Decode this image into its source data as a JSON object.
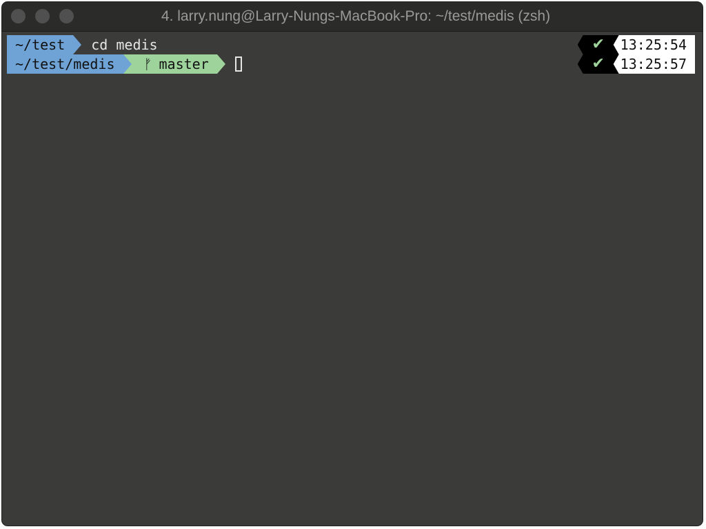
{
  "window": {
    "title": "4. larry.nung@Larry-Nungs-MacBook-Pro: ~/test/medis (zsh)"
  },
  "lines": [
    {
      "dir": "~/test",
      "command": "cd medis",
      "status_icon": "check-icon",
      "status_glyph": "✔",
      "time": "13:25:54"
    },
    {
      "dir": "~/test/medis",
      "branch_icon": "git-branch-icon",
      "branch_glyph": "ᚠ",
      "branch": "master",
      "status_icon": "check-icon",
      "status_glyph": "✔",
      "time": "13:25:57"
    }
  ],
  "colors": {
    "terminal_bg": "#3b3b39",
    "dir_segment": "#6fa3d6",
    "git_segment": "#9fd39c",
    "status_bg": "#000000",
    "status_ok": "#9fd39c",
    "time_bg": "#ffffff"
  }
}
